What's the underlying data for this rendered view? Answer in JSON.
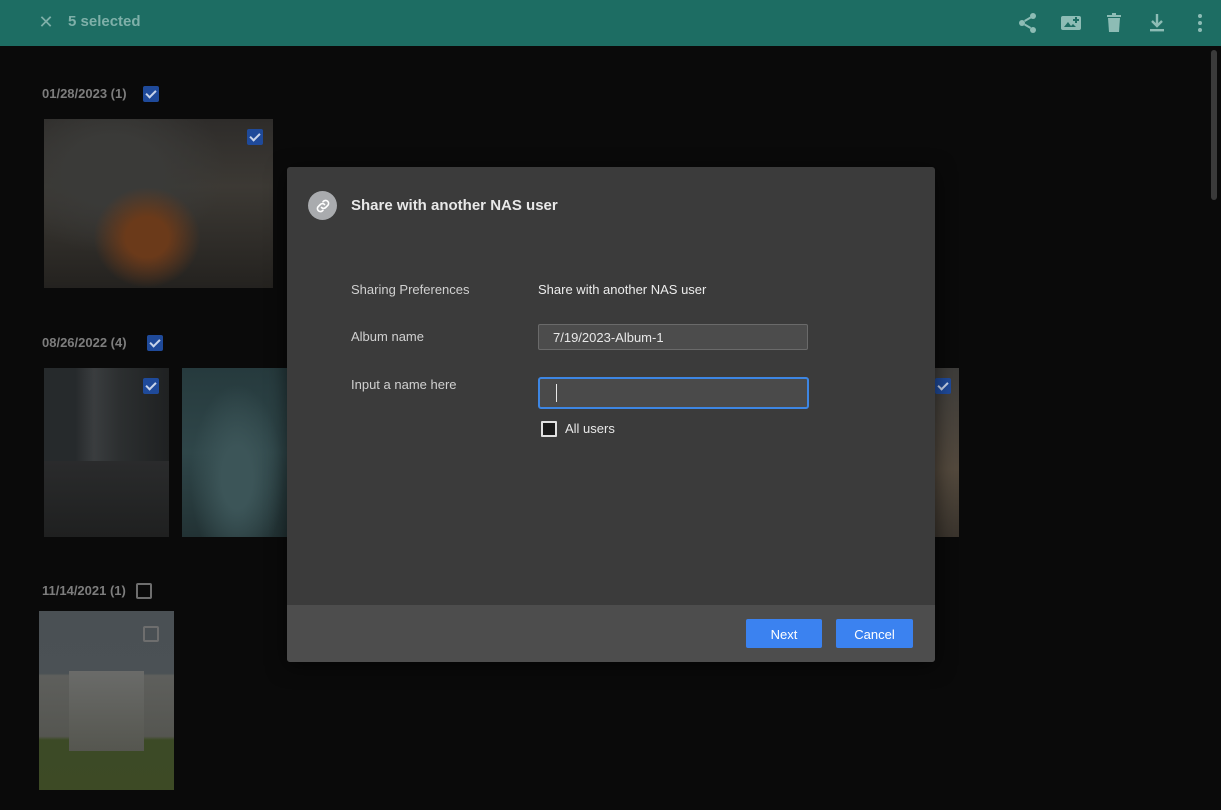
{
  "topbar": {
    "selected_text": "5 selected",
    "icons": [
      "share-icon",
      "add-to-album-icon",
      "delete-icon",
      "download-icon",
      "more-icon"
    ],
    "background": "#1d6d63"
  },
  "groups": [
    {
      "date": "01/28/2023 (1)",
      "checked": true
    },
    {
      "date": "08/26/2022 (4)",
      "checked": true
    },
    {
      "date": "11/14/2021 (1)",
      "checked": false
    }
  ],
  "dialog": {
    "title": "Share with another NAS user",
    "sharing_pref_label": "Sharing Preferences",
    "sharing_pref_value": "Share with another NAS user",
    "album_name_label": "Album name",
    "album_name_value": "7/19/2023-Album-1",
    "input_name_label": "Input a name here",
    "input_name_value": "",
    "all_users_label": "All users",
    "next_label": "Next",
    "cancel_label": "Cancel",
    "accent": "#3b82f0"
  }
}
